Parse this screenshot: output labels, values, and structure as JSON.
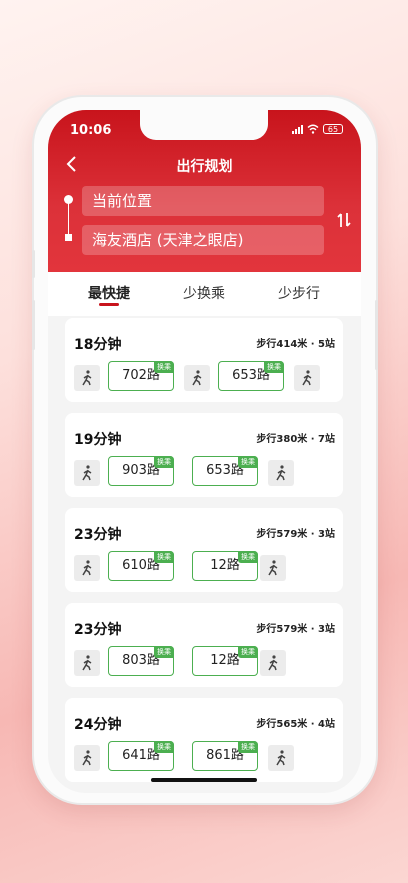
{
  "status": {
    "time": "10:06",
    "battery": "65"
  },
  "nav": {
    "title": "出行规划"
  },
  "origin": "当前位置",
  "destination": "海友酒店 (天津之眼店)",
  "tabs": [
    "最快捷",
    "少换乘",
    "少步行"
  ],
  "transfer_label": "换乘",
  "routes": [
    {
      "duration": "18分钟",
      "meta": "步行414米 · 5站",
      "buses": [
        "702路",
        "653路"
      ]
    },
    {
      "duration": "19分钟",
      "meta": "步行380米 · 7站",
      "buses": [
        "903路",
        "653路"
      ]
    },
    {
      "duration": "23分钟",
      "meta": "步行579米 · 3站",
      "buses": [
        "610路",
        "12路"
      ]
    },
    {
      "duration": "23分钟",
      "meta": "步行579米 · 3站",
      "buses": [
        "803路",
        "12路"
      ]
    },
    {
      "duration": "24分钟",
      "meta": "步行565米 · 4站",
      "buses": [
        "641路",
        "861路"
      ]
    }
  ],
  "colors": {
    "accent": "#c8141c",
    "transfer": "#4caf50"
  }
}
